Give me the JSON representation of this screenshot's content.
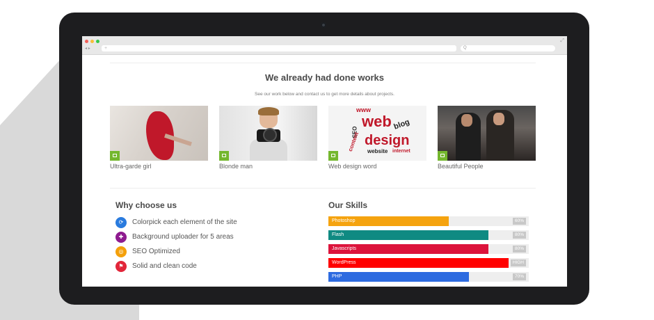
{
  "browser": {
    "address_placeholder": "+",
    "search_icon": "Q",
    "back_icon": "◂",
    "forward_icon": "▸",
    "expand_icon": "⤢"
  },
  "works": {
    "title": "We already had done works",
    "subtitle": "See our work below and contact us to get more details about projects.",
    "items": [
      {
        "caption": "Ultra-garde girl",
        "icon": "image-icon"
      },
      {
        "caption": "Blonde man",
        "icon": "image-icon"
      },
      {
        "caption": "Web design word",
        "icon": "image-icon"
      },
      {
        "caption": "Beautiful People",
        "icon": "image-icon"
      }
    ],
    "word_cloud": {
      "web": "web",
      "design": "design",
      "blog": "blog",
      "content": "content",
      "seo": "SEO",
      "website": "website",
      "internet": "internet",
      "www": "www"
    },
    "accent": "#74b72e"
  },
  "why": {
    "title": "Why choose us",
    "items": [
      {
        "text": "Colorpick each element of the site",
        "icon": "refresh-icon",
        "color": "#2a7bde",
        "glyph": "⟳"
      },
      {
        "text": "Background uploader for 5 areas",
        "icon": "gift-icon",
        "color": "#8e1b8f",
        "glyph": "✚"
      },
      {
        "text": "SEO Optimized",
        "icon": "compass-icon",
        "color": "#f4a00b",
        "glyph": "◎"
      },
      {
        "text": "Solid and clean code",
        "icon": "flag-icon",
        "color": "#e2263a",
        "glyph": "⚑"
      }
    ]
  },
  "skills": {
    "title": "Our Skills",
    "items": [
      {
        "name": "Photoshop",
        "value": 60,
        "label": "60%",
        "color": "#f5a30f"
      },
      {
        "name": "Flash",
        "value": 80,
        "label": "80%",
        "color": "#0f8a82"
      },
      {
        "name": "Javascripts",
        "value": 80,
        "label": "80%",
        "color": "#dc143c"
      },
      {
        "name": "WordPress",
        "value": 90,
        "label": "HIGH",
        "color": "#ff0000"
      },
      {
        "name": "PHP",
        "value": 70,
        "label": "70%",
        "color": "#2d6be0"
      }
    ]
  }
}
